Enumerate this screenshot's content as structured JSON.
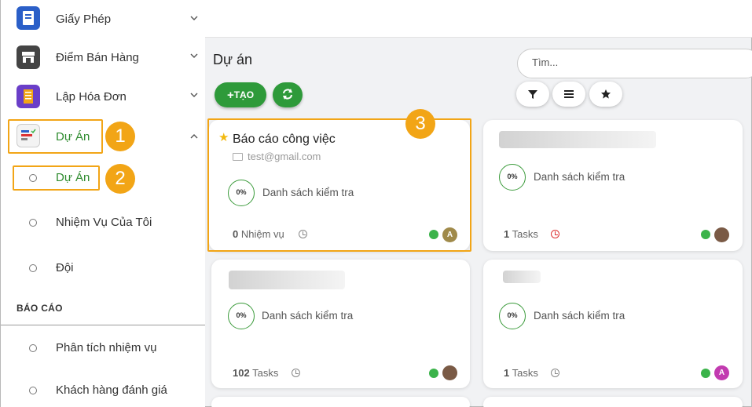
{
  "sidebar": {
    "items": [
      {
        "label": "Giấy Phép",
        "icon": "license-icon"
      },
      {
        "label": "Điểm Bán Hàng",
        "icon": "store-icon"
      },
      {
        "label": "Lập Hóa Đơn",
        "icon": "invoice-icon"
      },
      {
        "label": "Dự Án",
        "icon": "project-icon"
      }
    ],
    "subitems": [
      "Dự Án",
      "Nhiệm Vụ Của Tôi",
      "Đội"
    ],
    "section_title": "BÁO CÁO",
    "report_items": [
      "Phân tích nhiệm vụ",
      "Khách hàng đánh giá"
    ]
  },
  "badges": [
    "1",
    "2",
    "3"
  ],
  "main": {
    "page_title": "Dự án",
    "create_label": "TẠO",
    "search_placeholder": "Tìm..."
  },
  "cards": [
    {
      "title": "Báo cáo công việc",
      "email": "test@gmail.com",
      "progress": "0%",
      "checklist": "Danh sách kiểm tra",
      "tasks_count": "0",
      "tasks_label": "Nhiệm vụ",
      "avatar": "A",
      "avatar_color": "#a08a4a",
      "status_color": "#3bb34a"
    },
    {
      "title": "",
      "progress": "0%",
      "checklist": "Danh sách kiểm tra",
      "tasks_count": "1",
      "tasks_label": "Tasks",
      "status_color": "#3bb34a"
    },
    {
      "title": "",
      "progress": "0%",
      "checklist": "Danh sách kiểm tra",
      "tasks_count": "102",
      "tasks_label": "Tasks",
      "status_color": "#3bb34a"
    },
    {
      "title": "",
      "progress": "0%",
      "checklist": "Danh sách kiểm tra",
      "tasks_count": "1",
      "tasks_label": "Tasks",
      "avatar": "A",
      "avatar_color": "#c23bb0",
      "status_color": "#3bb34a"
    }
  ],
  "colors": {
    "accent": "#f2a516",
    "green": "#2e9a3a"
  }
}
